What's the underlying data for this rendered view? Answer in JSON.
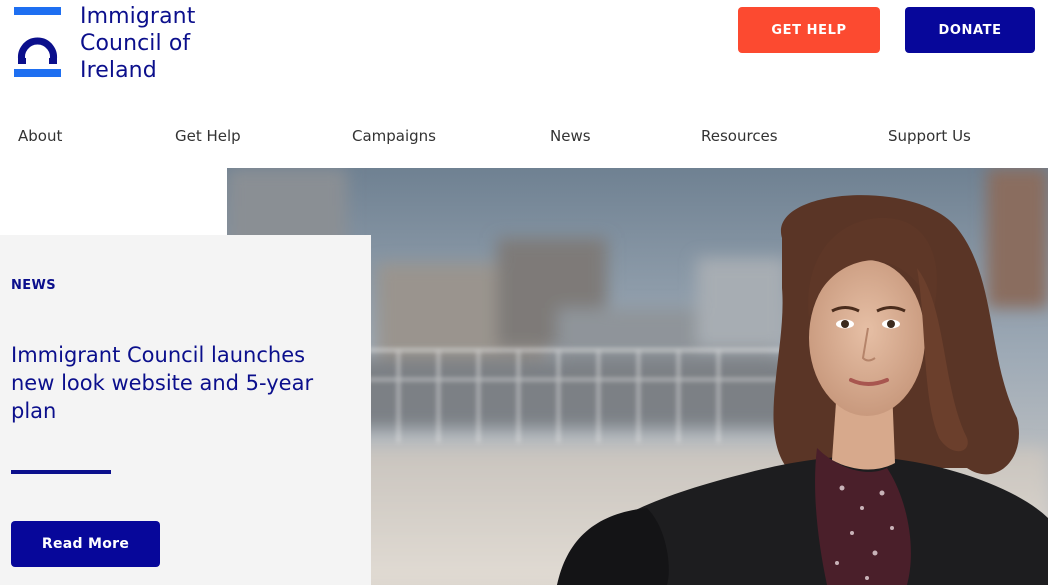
{
  "header": {
    "logo_lines": [
      "Immigrant",
      "Council of",
      "Ireland"
    ],
    "get_help_label": "GET HELP",
    "donate_label": "DONATE"
  },
  "nav": {
    "items": [
      {
        "label": "About"
      },
      {
        "label": "Get Help"
      },
      {
        "label": "Campaigns"
      },
      {
        "label": "News"
      },
      {
        "label": "Resources"
      },
      {
        "label": "Support Us"
      }
    ]
  },
  "feature": {
    "tag": "NEWS",
    "title": "Immigrant Council launches new look website and 5-year plan",
    "read_more_label": "Read More"
  },
  "colors": {
    "brand_navy": "#0b0f8c",
    "button_navy": "#07079a",
    "get_help_red": "#fc4a30",
    "logo_blue": "#1e6ff1",
    "card_bg": "#f4f4f4"
  },
  "icons": {
    "logo_mark": "logo-mark-icon"
  }
}
